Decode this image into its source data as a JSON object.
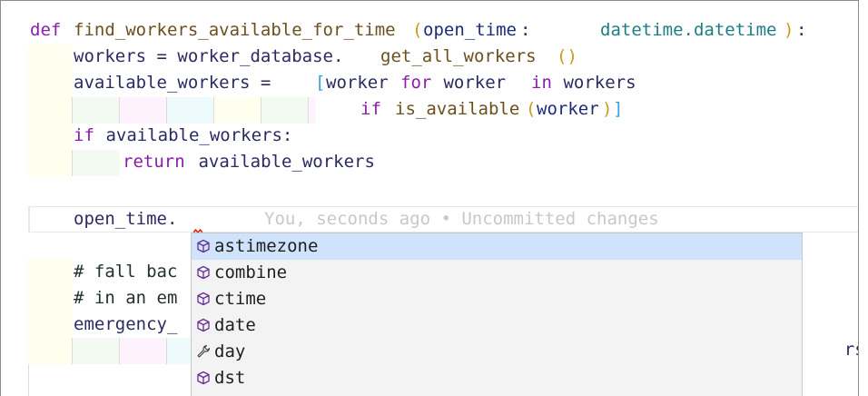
{
  "editor": {
    "lines": {
      "def": "def",
      "func_name": "find_workers_available_for_time",
      "open_paren": "(",
      "param": "open_time",
      "colon_space": ": ",
      "type": "datetime.datetime",
      "close_paren": ")",
      "def_colon": ":",
      "l2_prefix": "workers = worker_database.",
      "l2_call": "get_all_workers",
      "l2_parens": "()",
      "l3_prefix": "available_workers = ",
      "l3_bracket": "[",
      "l3_a": "worker ",
      "l3_for": "for",
      "l3_b": " worker ",
      "l3_in": "in",
      "l3_c": " workers",
      "l4_if": "if",
      "l4_fn": "is_available",
      "l4_open": "(",
      "l4_arg": "worker",
      "l4_close": ")",
      "l4_bracket": "]",
      "l5_if": "if",
      "l5_rest": " available_workers:",
      "l6_return": "return",
      "l6_rest": " available_workers",
      "l8_code": "open_time.",
      "l8_blame": "You, seconds ago • Uncommitted changes",
      "l10_comment": "# fall bac",
      "l11_comment": "# in an em",
      "l12_code": "emergency_",
      "l12_tail": "rs()"
    }
  },
  "suggest": {
    "items": [
      {
        "label": "astimezone",
        "icon": "cube-method-icon"
      },
      {
        "label": "combine",
        "icon": "cube-method-icon"
      },
      {
        "label": "ctime",
        "icon": "cube-method-icon"
      },
      {
        "label": "date",
        "icon": "cube-method-icon"
      },
      {
        "label": "day",
        "icon": "wrench-property-icon"
      },
      {
        "label": "dst",
        "icon": "cube-method-icon"
      }
    ],
    "selected_index": 0
  },
  "colors": {
    "keyword": "#8a1ea8",
    "function": "#6b4f1e",
    "type": "#1d7d84",
    "selection": "#cfe4fc"
  }
}
